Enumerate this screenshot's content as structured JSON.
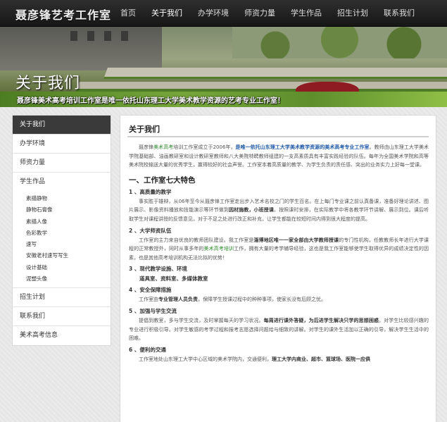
{
  "header": {
    "logo": "聂彦锋艺考工作室",
    "nav": [
      "首页",
      "关于我们",
      "办学环境",
      "师资力量",
      "学生作品",
      "招生计划",
      "联系我们"
    ]
  },
  "banner": {
    "title": "关于我们",
    "subtitle": "聂彦锋美术高考培训工作室是唯一依托山东理工大学美术教学资源的艺考专业工作室！"
  },
  "sidebar": {
    "items": [
      "关于我们",
      "办学环境",
      "师资力量",
      "学生作品"
    ],
    "sub_items": [
      "素描静物",
      "静物石膏像",
      "素描人像",
      "色彩教学",
      "速写",
      "安徽老村速写写生",
      "设计基础",
      "泥塑头像"
    ],
    "items_after": [
      "招生计划",
      "联系我们",
      "美术高考信息"
    ]
  },
  "content": {
    "title": "关于我们",
    "intro": {
      "a": "聂彦锋",
      "b": "美术高考",
      "c": "培训工作室成立于2006年，",
      "d": "是唯一依托山东理工大学美术教学资源的美术高考专业工作室",
      "e": "。教师由山东理工大学美术学院基础部、油画教研室和设计教研室教师和八大美院特聘教师组建的一支高素质具有丰富实践经验的队伍。每年为全国美术学院和高等美术院校输送大量的优秀学生，赢得较好的社会声誉。工作室本着高质量的教学、为学生负责的责任感、突出的业务实力上好每一堂课。"
    },
    "section_title": "一、工作室七大特色",
    "f1": {
      "title": "1 、高质量的教学",
      "a": "事实胜于雄辩，从06年至今从聂彦锋工作室走出步入艺术名校之门的学生百名。在上每门专业课之前认真备课，准备好理论讲述、图片展示、影像资料播放和技能演示等环节做到",
      "b": "因材施教，小班授课",
      "c": "。按照课时安排，在实际教学中将各教学环节讲解、展示到位。课后听取学生对课程讲授的反馈意见，对于不足之处进行改正和补充，让学生都能在较短时间内得到很大程度的提高。"
    },
    "f2": {
      "title": "2 、大学师资队伍",
      "a": "工作室的主力来自优良的教师团队建设。我工作室是",
      "b": "淄博地区唯一一家全部由大学教师授课",
      "c": "的专门性机构，任教教师长年进行大学课程的正常教授外，同时从事多年的",
      "d": "美术高考培训",
      "e": "工作，拥有大量的考学辅导经验，这也是我工作室能够使学生取得优异的成绩决定性的因素，也是其他高考培训机构无法比拟的优势！"
    },
    "f3": {
      "title": "3 、现代教学设施、环境",
      "line": "道具室、资料室、多媒体教室"
    },
    "f4": {
      "title": "4 、安全保障措施",
      "a": "工作室由",
      "b": "专业管理人员负责",
      "c": "，保障学生授课过程中的种种事项，使家长没有后顾之忧。"
    },
    "f5": {
      "title": "5 、加强与学生交流",
      "a": "提倡到教室，多与学生交流，及时掌握每天的学习状况。",
      "b": "每周进行课外答疑，为后进学生解决只学的思想困惑",
      "c": "。对学生比较感兴趣的专业进行积极引导。对学生敏感的考学过程和报考志愿选择问题给与细致的讲解。对学生的课外生活加以正确的引导，解决学生生活中的困难。"
    },
    "f6": {
      "title": "6 、便利的交通",
      "a": "工作室地处山东理工大学中心区域的美术学院内，交通便利，",
      "b": "理工大学内商业、超市、篮球场、医院一应俱"
    }
  }
}
